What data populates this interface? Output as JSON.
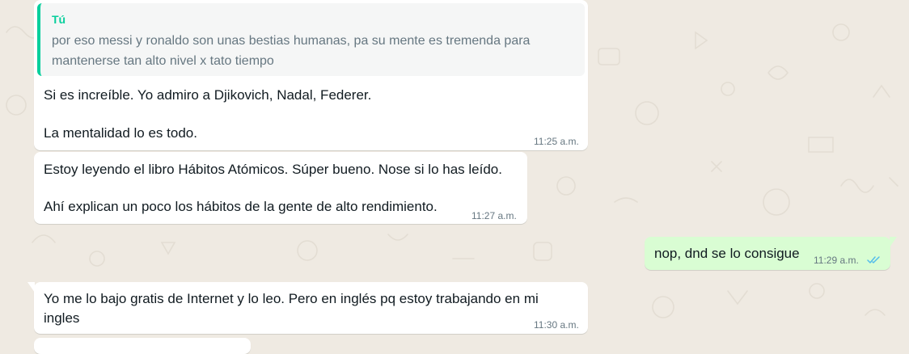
{
  "chat": {
    "messages": [
      {
        "direction": "incoming",
        "quote": {
          "author": "Tú",
          "text": "por eso messi y ronaldo son unas bestias humanas, pa su mente es tremenda para mantenerse tan alto nivel x tato tiempo"
        },
        "lines": [
          "Si es increíble. Yo admiro a Djikovich, Nadal, Federer.",
          "La mentalidad lo es todo."
        ],
        "time": "11:25 a.m."
      },
      {
        "direction": "incoming",
        "lines": [
          "Estoy leyendo el libro Hábitos Atómicos. Súper bueno. Nose si lo has leído.",
          "Ahí explican un poco los hábitos de la gente de alto rendimiento."
        ],
        "time": "11:27 a.m."
      },
      {
        "direction": "outgoing",
        "lines": [
          "nop, dnd se lo consigue"
        ],
        "time": "11:29 a.m.",
        "status": "read"
      },
      {
        "direction": "incoming",
        "lines": [
          "Yo me lo bajo gratis de Internet y lo leo. Pero en inglés pq estoy trabajando en mi ingles"
        ],
        "time": "11:30 a.m."
      }
    ]
  },
  "icons": {
    "read_receipt": "double-check-icon",
    "tick_color": "#53bdeb"
  },
  "colors": {
    "background": "#efeae2",
    "incoming_bubble": "#ffffff",
    "outgoing_bubble": "#d9fdd3",
    "quote_accent": "#06cf9c",
    "quote_background": "#f5f6f6",
    "timestamp": "#667781"
  }
}
